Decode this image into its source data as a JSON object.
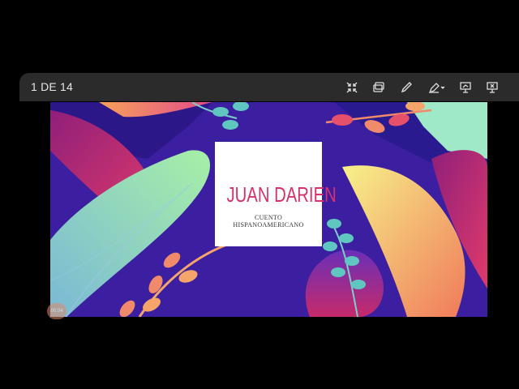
{
  "toolbar": {
    "page_counter": "1 DE 14",
    "icons": [
      "collapse-icon",
      "present-mode-icon",
      "pen-icon",
      "highlighter-dropdown-icon",
      "presenter-view-icon",
      "exit-presentation-icon"
    ]
  },
  "slide": {
    "title": "JUAN DARIEN",
    "subtitle_line1": "CUENTO",
    "subtitle_line2": "HISPANOAMERICANO",
    "title_color": "#d6336c"
  },
  "timer": {
    "label": "00:04"
  },
  "colors": {
    "toolbar_bg": "#2b2b2b",
    "background": "#000000",
    "slide_bg": "#3a1f9a"
  }
}
